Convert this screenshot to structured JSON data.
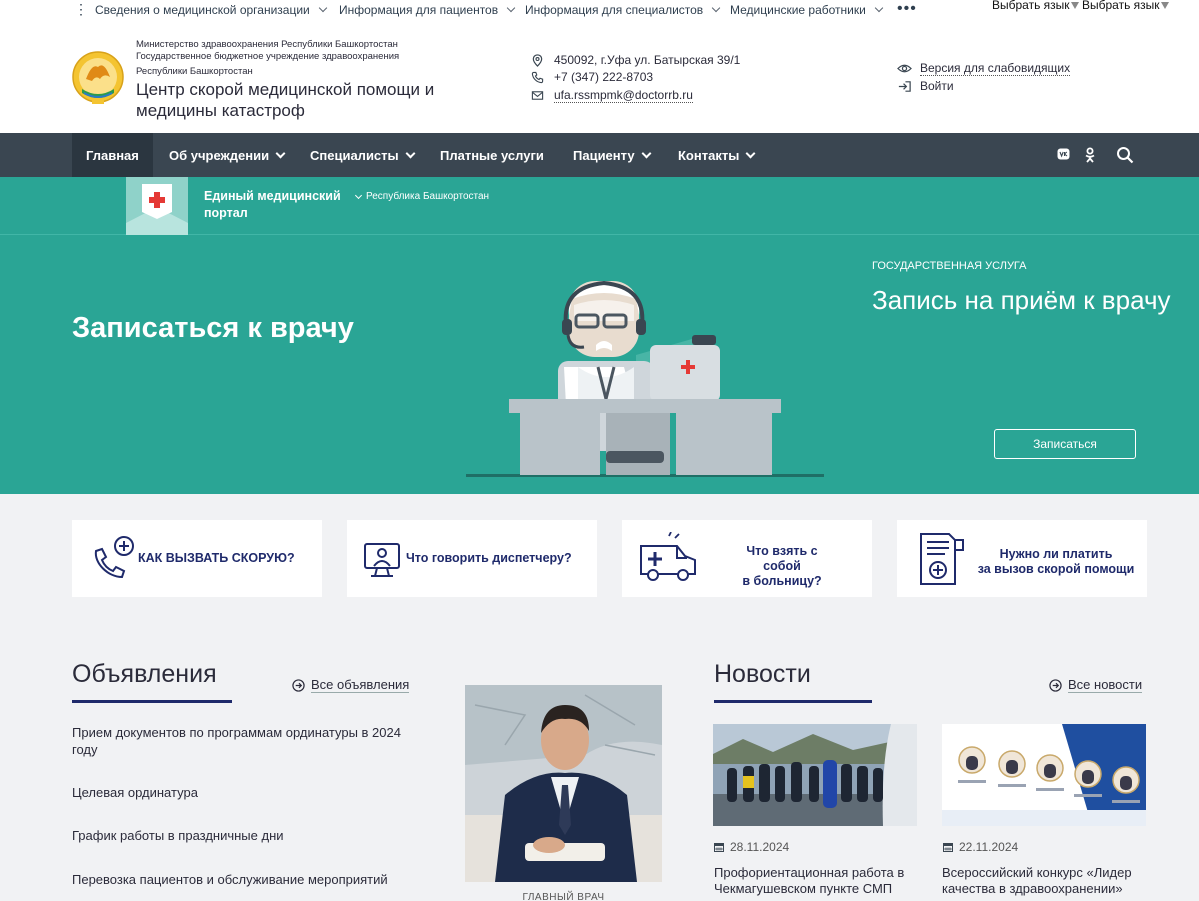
{
  "topbar": {
    "menu": [
      {
        "label": "Сведения о медицинской организации"
      },
      {
        "label": "Информация для пациентов"
      },
      {
        "label": "Информация для специалистов"
      },
      {
        "label": "Медицинские работники"
      }
    ],
    "more": "•••",
    "lang1": "Выбрать язык",
    "lang2": "Выбрать язык"
  },
  "header": {
    "ministry": "Министерство здравоохранения Республики Башкортостан",
    "institution": "Государственное бюджетное учреждение здравоохранения",
    "republic": "Республики Башкортостан",
    "title": "Центр скорой медицинской помощи и медицины катастроф",
    "address": "450092, г.Уфа ул. Батырская 39/1",
    "phone": "+7 (347) 222-8703",
    "email": "ufa.rssmpmk@doctorrb.ru",
    "accessibility": "Версия для слабовидящих",
    "login": "Войти"
  },
  "nav": {
    "items": [
      {
        "label": "Главная"
      },
      {
        "label": "Об учреждении"
      },
      {
        "label": "Специалисты"
      },
      {
        "label": "Платные услуги"
      },
      {
        "label": "Пациенту"
      },
      {
        "label": "Контакты"
      }
    ]
  },
  "portal": {
    "title": "Единый медицинский портал",
    "region": "Республика Башкортостан"
  },
  "hero": {
    "title": "Записаться к врачу",
    "eyebrow": "ГОСУДАРСТВЕННАЯ УСЛУГА",
    "service": "Запись на приём к врачу",
    "button": "Записаться"
  },
  "cards": [
    {
      "line1": "КАК ВЫЗВАТЬ СКОРУЮ?",
      "line2": ""
    },
    {
      "line1": "Что говорить диспетчеру?",
      "line2": ""
    },
    {
      "line1": "Что взять с собой",
      "line2": "в больницу?"
    },
    {
      "line1": "Нужно ли платить",
      "line2": "за вызов скорой помощи"
    }
  ],
  "announcements": {
    "title": "Объявления",
    "all_link": "Все объявления",
    "items": [
      {
        "text": "Прием документов по программам ординатуры в 2024 году"
      },
      {
        "text": "Целевая ординатура"
      },
      {
        "text": "График работы в праздничные дни"
      },
      {
        "text": "Перевозка пациентов и обслуживание мероприятий"
      }
    ]
  },
  "chief": {
    "caption": "ГЛАВНЫЙ ВРАЧ"
  },
  "news": {
    "title": "Новости",
    "all_link": "Все новости",
    "items": [
      {
        "date": "28.11.2024",
        "title": "Профориентационная работа в Чекмагушевском пункте СМП"
      },
      {
        "date": "22.11.2024",
        "title": "Всероссийский конкурс «Лидер качества в здравоохранении»"
      }
    ]
  },
  "colors": {
    "teal": "#2aa595",
    "nav": "#3a4651",
    "navy": "#1f2a6b"
  }
}
